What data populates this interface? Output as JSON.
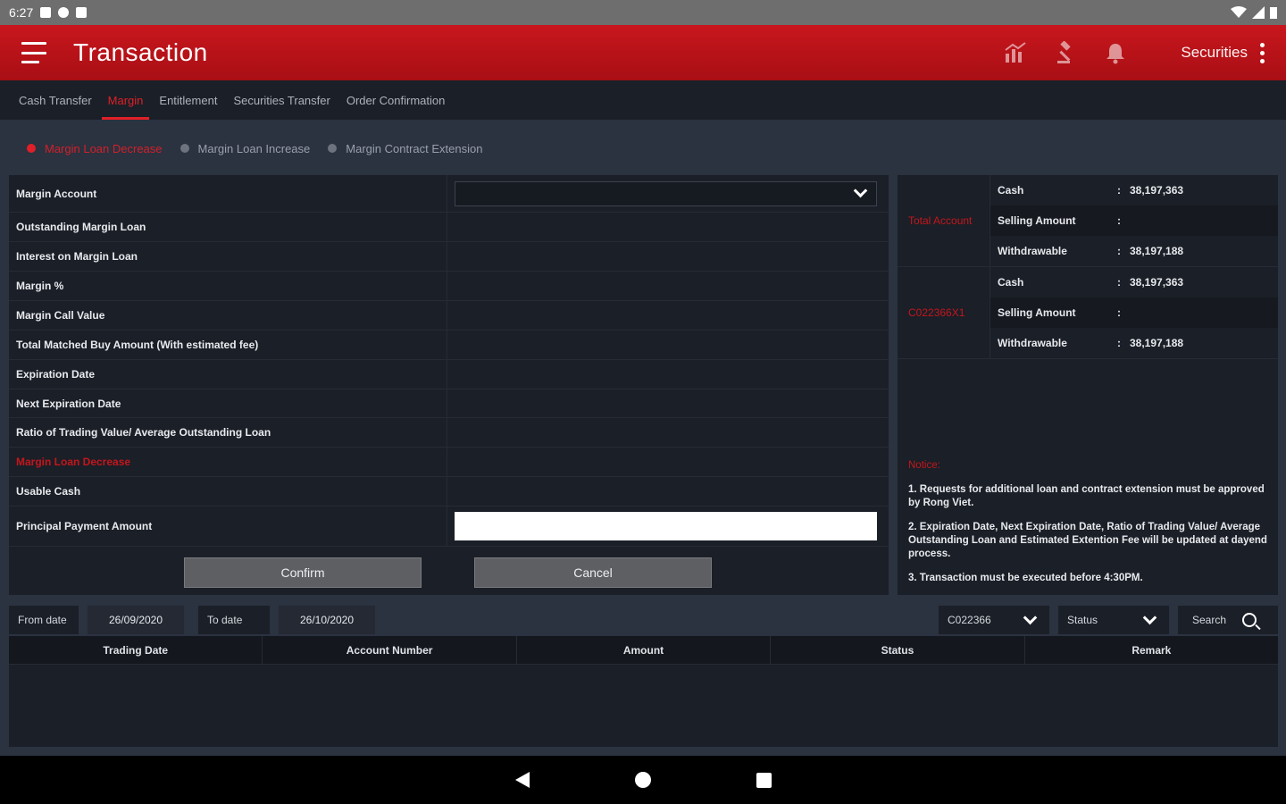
{
  "status_bar": {
    "time": "6:27"
  },
  "app_bar": {
    "title": "Transaction",
    "account_type": "Securities"
  },
  "tabs": [
    {
      "label": "Cash Transfer",
      "active": false
    },
    {
      "label": "Margin",
      "active": true
    },
    {
      "label": "Entitlement",
      "active": false
    },
    {
      "label": "Securities Transfer",
      "active": false
    },
    {
      "label": "Order Confirmation",
      "active": false
    }
  ],
  "radios": [
    {
      "label": "Margin Loan Decrease",
      "active": true
    },
    {
      "label": "Margin Loan Increase",
      "active": false
    },
    {
      "label": "Margin Contract Extension",
      "active": false
    }
  ],
  "form": {
    "rows": [
      {
        "label": "Margin Account"
      },
      {
        "label": "Outstanding Margin Loan"
      },
      {
        "label": "Interest on Margin Loan"
      },
      {
        "label": "Margin %"
      },
      {
        "label": "Margin Call Value"
      },
      {
        "label": "Total Matched Buy Amount (With estimated fee)"
      },
      {
        "label": "Expiration Date"
      },
      {
        "label": "Next Expiration Date"
      },
      {
        "label": "Ratio of Trading Value/ Average Outstanding Loan"
      },
      {
        "label": "Margin Loan Decrease"
      },
      {
        "label": "Usable Cash"
      },
      {
        "label": "Principal Payment Amount"
      }
    ],
    "confirm_label": "Confirm",
    "cancel_label": "Cancel"
  },
  "accounts": [
    {
      "name": "Total Account",
      "rows": [
        {
          "key": "Cash",
          "value": "38,197,363"
        },
        {
          "key": "Selling Amount",
          "value": ""
        },
        {
          "key": "Withdrawable",
          "value": "38,197,188"
        }
      ]
    },
    {
      "name": "C022366X1",
      "rows": [
        {
          "key": "Cash",
          "value": "38,197,363"
        },
        {
          "key": "Selling Amount",
          "value": ""
        },
        {
          "key": "Withdrawable",
          "value": "38,197,188"
        }
      ]
    }
  ],
  "notice": {
    "title": "Notice:",
    "items": [
      "1. Requests for additional loan and contract extension must be approved by Rong Viet.",
      "2. Expiration Date, Next Expiration Date, Ratio of Trading Value/ Average Outstanding Loan and Estimated Extention Fee will be updated at dayend process.",
      "3. Transaction must be executed before 4:30PM."
    ]
  },
  "filter": {
    "from_label": "From date",
    "from_value": "26/09/2020",
    "to_label": "To date",
    "to_value": "26/10/2020",
    "account_value": "C022366",
    "status_placeholder": "Status",
    "search_label": "Search"
  },
  "table": {
    "headers": [
      "Trading Date",
      "Account Number",
      "Amount",
      "Status",
      "Remark"
    ]
  },
  "colors": {
    "brand_red": "#c8161d",
    "accent_red": "#e02028",
    "panel_bg": "#1b1f27"
  }
}
